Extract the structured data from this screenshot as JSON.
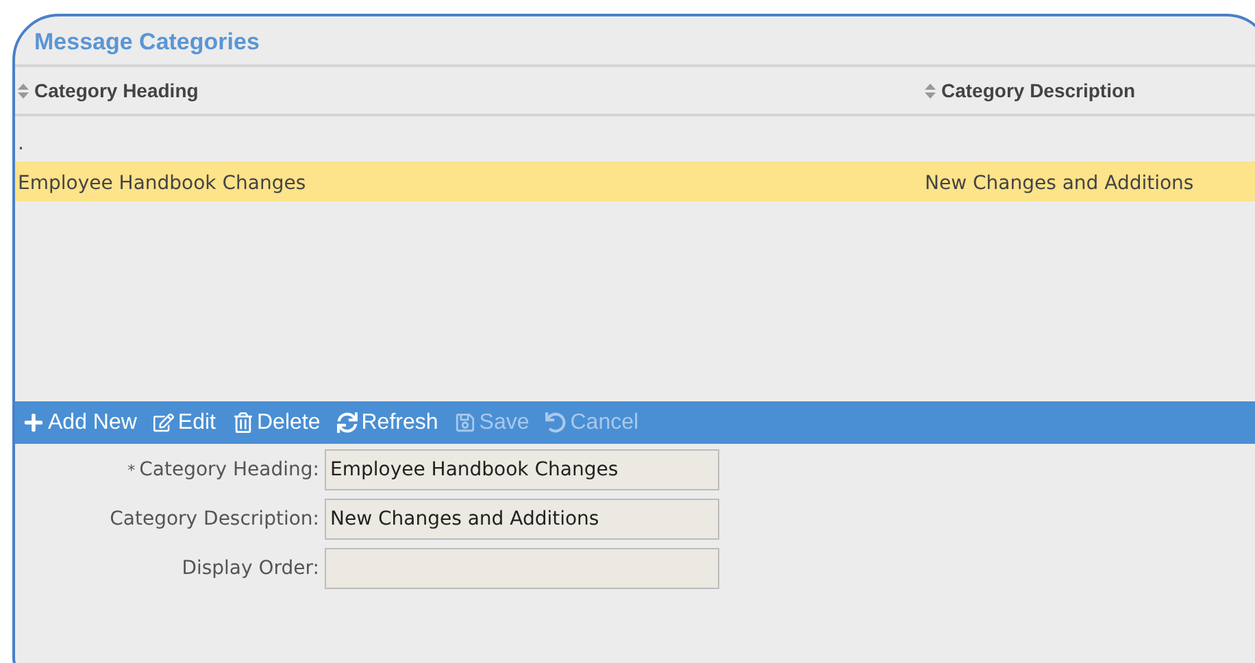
{
  "panel": {
    "title": "Message Categories"
  },
  "table": {
    "columns": [
      {
        "label": "Category Heading"
      },
      {
        "label": "Category Description"
      }
    ],
    "rows": [
      {
        "cells": [
          ".",
          ""
        ],
        "selected": false
      },
      {
        "cells": [
          "Employee Handbook Changes",
          "New Changes and Additions"
        ],
        "selected": true
      }
    ]
  },
  "toolbar": [
    {
      "kind": "add",
      "label": "Add New",
      "disabled": false
    },
    {
      "kind": "edit",
      "label": "Edit",
      "disabled": false
    },
    {
      "kind": "delete",
      "label": "Delete",
      "disabled": false
    },
    {
      "kind": "refresh",
      "label": "Refresh",
      "disabled": false
    },
    {
      "kind": "save",
      "label": "Save",
      "disabled": true
    },
    {
      "kind": "cancel",
      "label": "Cancel",
      "disabled": true
    }
  ],
  "form": [
    {
      "label": "Category Heading:",
      "required_mark": "*",
      "value": "Employee Handbook Changes"
    },
    {
      "label": "Category Description:",
      "value": "New Changes and Additions"
    },
    {
      "label": "Display Order:"
    }
  ]
}
